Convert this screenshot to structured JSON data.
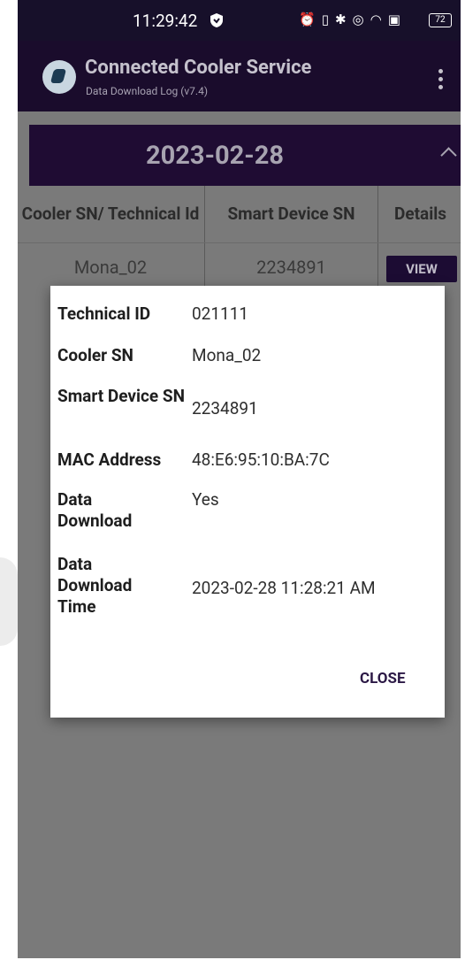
{
  "status_bar": {
    "time": "11:29:42",
    "icons": [
      "vpn-shield-icon",
      "alarm-icon",
      "vibrate-icon",
      "bluetooth-icon",
      "location-icon",
      "wifi-icon",
      "nfc-icon"
    ],
    "battery": "72"
  },
  "app_bar": {
    "title": "Connected Cooler Service",
    "subtitle": "Data Download Log (v7.4)"
  },
  "section": {
    "date": "2023-02-28"
  },
  "table": {
    "headers": [
      "Cooler SN/ Technical Id",
      "Smart Device SN",
      "Details"
    ],
    "rows": [
      {
        "cooler_sn": "Mona_02",
        "smart_device_sn": "2234891",
        "action_label": "VIEW"
      }
    ]
  },
  "dialog": {
    "fields": [
      {
        "label": "Technical ID",
        "value": "021111"
      },
      {
        "label": "Cooler SN",
        "value": "Mona_02"
      },
      {
        "label": "Smart Device SN",
        "value": "2234891"
      },
      {
        "label": "MAC Address",
        "value": "48:E6:95:10:BA:7C"
      },
      {
        "label": "Data Download",
        "value": "Yes"
      },
      {
        "label": "Data Download Time",
        "value": "2023-02-28 11:28:21 AM"
      }
    ],
    "close_label": "CLOSE"
  },
  "colors": {
    "app_bar_bg": "#1a0c2c",
    "status_bar_bg": "#17102a",
    "accent": "#1f0c33",
    "scrim": "#7a7a7a"
  }
}
